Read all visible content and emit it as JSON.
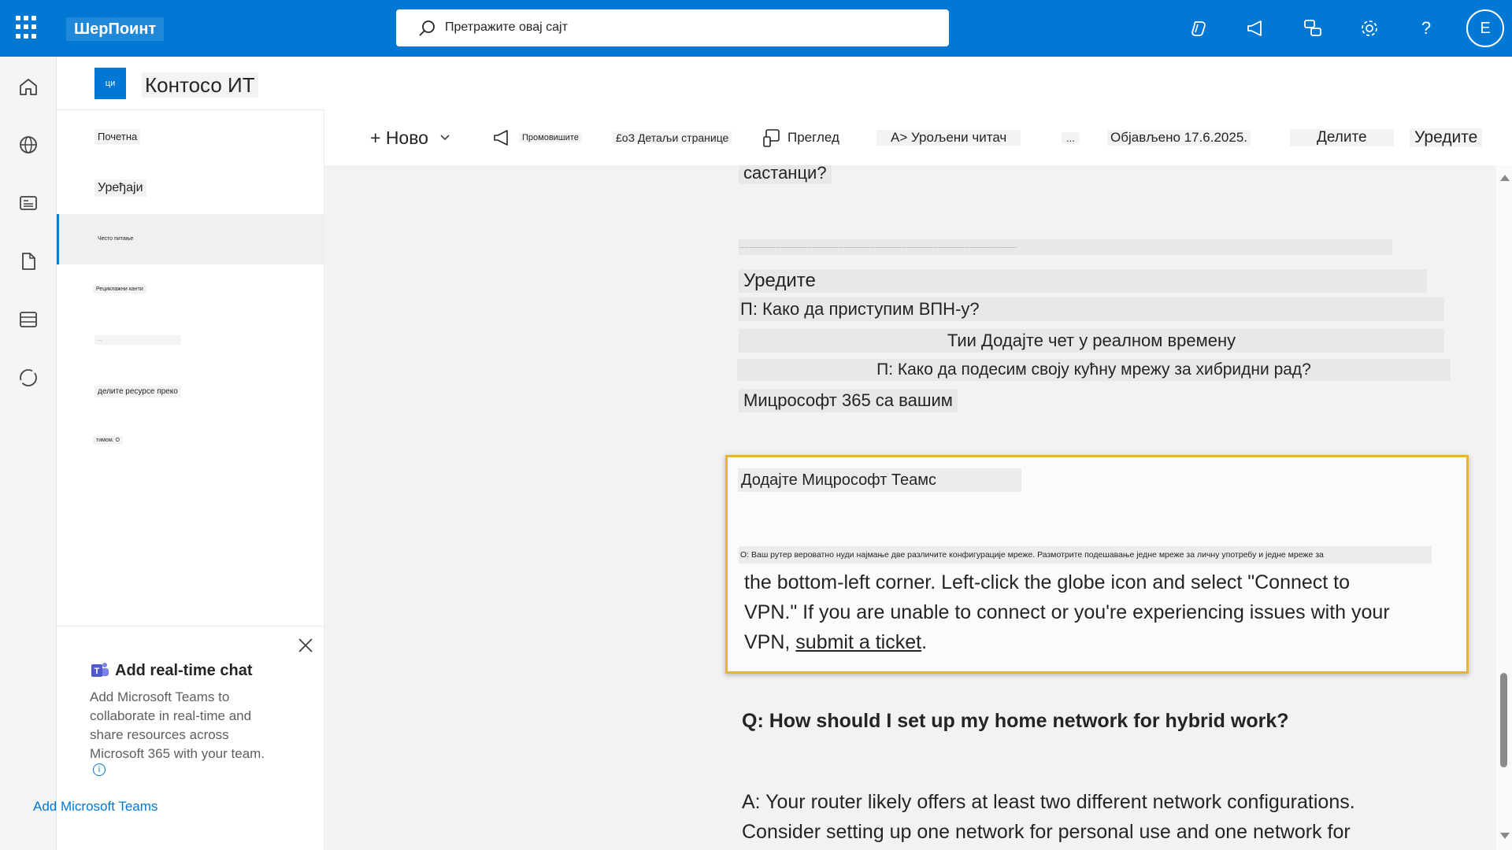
{
  "suite": {
    "app_name": "ШерПоинт",
    "search_placeholder": "Претражите овај сајт",
    "avatar_initial": "E"
  },
  "site": {
    "logo_text": "ци",
    "title": "Контосо ИТ"
  },
  "nav": {
    "items": [
      {
        "label": "Почетна"
      },
      {
        "label": "Уређаји"
      },
      {
        "label": "Често питање"
      },
      {
        "label": "Рециклажни канти"
      },
      {
        "label": "..."
      },
      {
        "label": "делите ресурсе преко"
      },
      {
        "label": "тимом. О"
      }
    ]
  },
  "commands": {
    "new": "+ Ново",
    "promote": "Промовишите",
    "page_details": "£оЗ Детаљи странице",
    "preview": "Преглед",
    "immersive_reader": "А> Урољени читач",
    "more": "...",
    "published": "Објављено 17.6.2025.",
    "share": "Делите",
    "edit": "Уредите"
  },
  "content": {
    "meetings": "састанци?",
    "tiny_line": "....................................................................................................................................................................................................................",
    "edit_heading": "Уредите",
    "q_vpn": "П: Како да приступим ВПН-у?",
    "add_chat": "Тии Додајте чет у реалном времену",
    "q_home_network": "П: Како да подесим своју кућну мрежу за хибридни рад?",
    "m365_with": "Мицрософт 365 са вашим",
    "add_teams": "Додајте Мицрософт Теамс",
    "a_router_sr": "О: Ваш рутер вероватно нуди најмање две различите конфигурације мреже. Размотрите подешавање једне мреже за личну употребу и једне мреже за",
    "vpn_para_1": "the bottom-left corner. Left-click the globe icon and select \"Connect to",
    "vpn_para_2": "VPN.\" If you are unable to connect or you're experiencing issues with your",
    "vpn_para_3_pre": "VPN, ",
    "vpn_link": "submit a ticket",
    "vpn_para_3_post": ".",
    "q_hybrid": "Q: How should I set up my home network for hybrid work?",
    "a_router_1": "A: Your router likely offers at least two different network configurations.",
    "a_router_2": "Consider setting up one network for personal use and one network for"
  },
  "chat_card": {
    "title": "Add real-time chat",
    "body": "Add Microsoft Teams to collaborate in real-time and share resources across Microsoft 365 with your team.",
    "info": "i",
    "link": "Add Microsoft Teams"
  },
  "colors": {
    "suite_bar": "#0078d4",
    "highlight_border": "#e8b33b",
    "canvas": "#f3f2f1"
  }
}
